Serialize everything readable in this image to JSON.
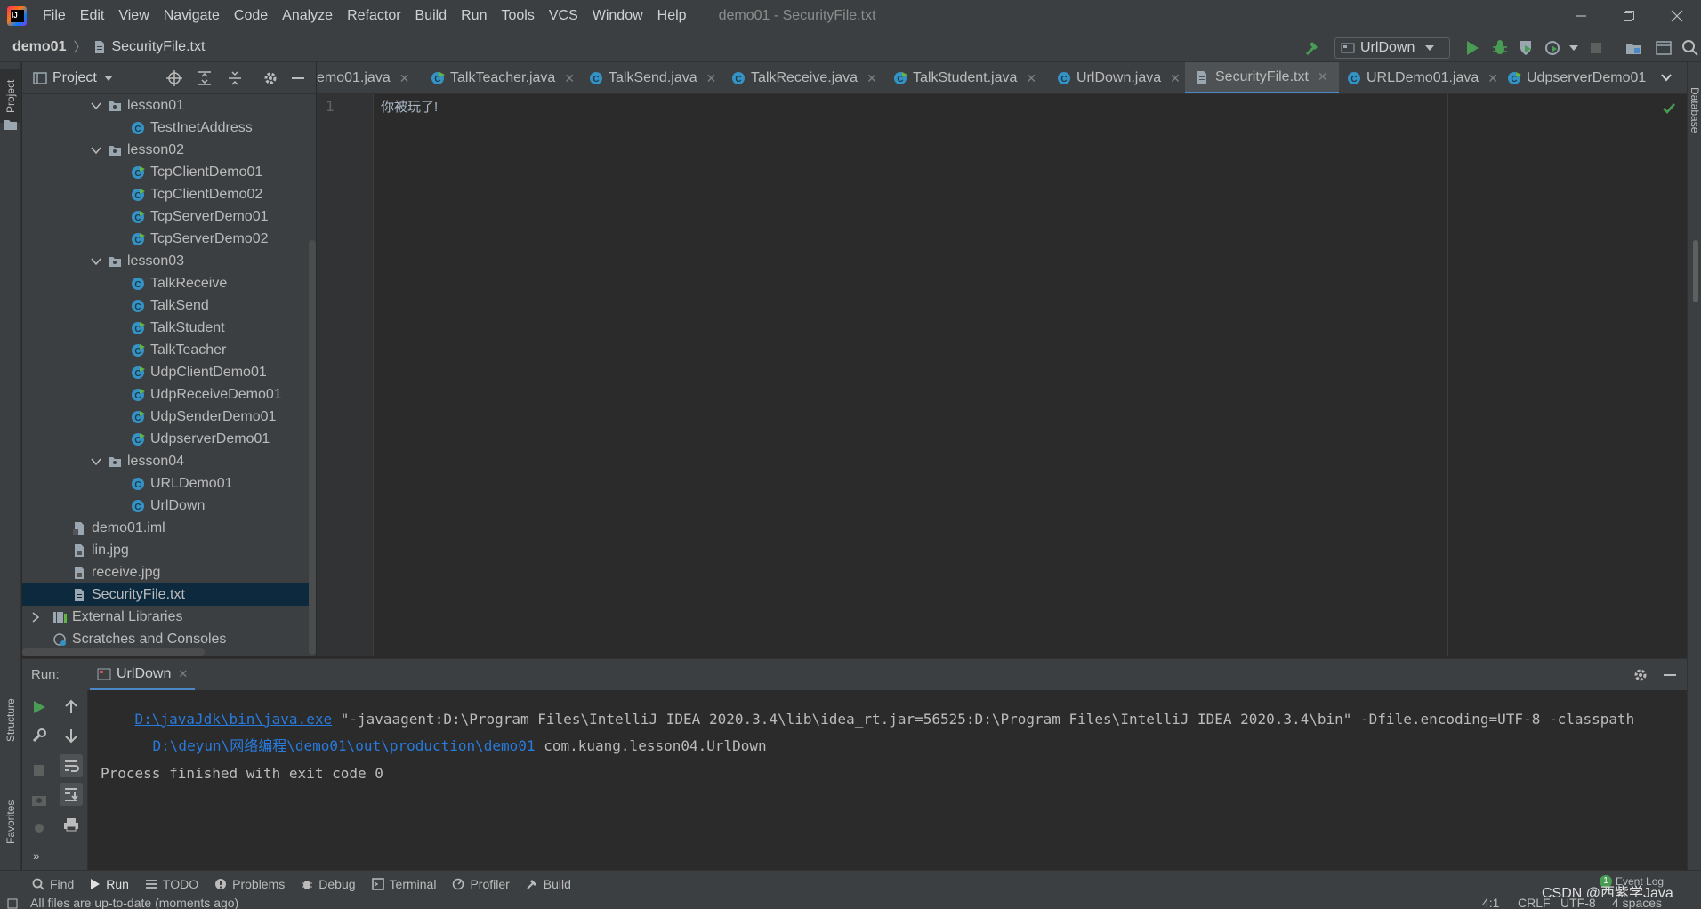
{
  "menu": {
    "items": [
      "File",
      "Edit",
      "View",
      "Navigate",
      "Code",
      "Analyze",
      "Refactor",
      "Build",
      "Run",
      "Tools",
      "VCS",
      "Window",
      "Help"
    ],
    "window_title": "demo01 - SecurityFile.txt"
  },
  "navbar": {
    "project": "demo01",
    "file": "SecurityFile.txt",
    "run_config": "UrlDown"
  },
  "project_panel": {
    "title": "Project",
    "tree": [
      {
        "label": "lesson01",
        "kind": "folder",
        "level": 1,
        "expanded": true
      },
      {
        "label": "TestInetAddress",
        "kind": "class",
        "level": 2
      },
      {
        "label": "lesson02",
        "kind": "folder",
        "level": 1,
        "expanded": true
      },
      {
        "label": "TcpClientDemo01",
        "kind": "class",
        "level": 2
      },
      {
        "label": "TcpClientDemo02",
        "kind": "class",
        "level": 2
      },
      {
        "label": "TcpServerDemo01",
        "kind": "class",
        "level": 2
      },
      {
        "label": "TcpServerDemo02",
        "kind": "class",
        "level": 2
      },
      {
        "label": "lesson03",
        "kind": "folder",
        "level": 1,
        "expanded": true
      },
      {
        "label": "TalkReceive",
        "kind": "class",
        "level": 2
      },
      {
        "label": "TalkSend",
        "kind": "class",
        "level": 2
      },
      {
        "label": "TalkStudent",
        "kind": "class",
        "level": 2
      },
      {
        "label": "TalkTeacher",
        "kind": "class",
        "level": 2
      },
      {
        "label": "UdpClientDemo01",
        "kind": "class",
        "level": 2
      },
      {
        "label": "UdpReceiveDemo01",
        "kind": "class",
        "level": 2
      },
      {
        "label": "UdpSenderDemo01",
        "kind": "class",
        "level": 2
      },
      {
        "label": "UdpserverDemo01",
        "kind": "class",
        "level": 2
      },
      {
        "label": "lesson04",
        "kind": "folder",
        "level": 1,
        "expanded": true
      },
      {
        "label": "URLDemo01",
        "kind": "class",
        "level": 2
      },
      {
        "label": "UrlDown",
        "kind": "class",
        "level": 2
      },
      {
        "label": "demo01.iml",
        "kind": "file",
        "level": 0
      },
      {
        "label": "lin.jpg",
        "kind": "file",
        "level": 0
      },
      {
        "label": "receive.jpg",
        "kind": "file",
        "level": 0
      },
      {
        "label": "SecurityFile.txt",
        "kind": "file",
        "level": 0,
        "selected": true
      },
      {
        "label": "External Libraries",
        "kind": "libraries",
        "level": -1,
        "expanded": false
      },
      {
        "label": "Scratches and Consoles",
        "kind": "scratches",
        "level": -1
      }
    ]
  },
  "editor_tabs": [
    {
      "label": "emo01.java",
      "icon": "none"
    },
    {
      "label": "TalkTeacher.java",
      "icon": "class"
    },
    {
      "label": "TalkSend.java",
      "icon": "class"
    },
    {
      "label": "TalkReceive.java",
      "icon": "class"
    },
    {
      "label": "TalkStudent.java",
      "icon": "class"
    },
    {
      "label": "UrlDown.java",
      "icon": "class"
    },
    {
      "label": "SecurityFile.txt",
      "icon": "text",
      "active": true
    },
    {
      "label": "URLDemo01.java",
      "icon": "class"
    },
    {
      "label": "UdpserverDemo01",
      "icon": "class"
    }
  ],
  "editor": {
    "line_number": "1",
    "content": "你被玩了!"
  },
  "run_panel": {
    "label": "Run:",
    "tab": "UrlDown",
    "console": {
      "line1_link": "D:\\javaJdk\\bin\\java.exe",
      "line1_rest": " \"-javaagent:D:\\Program Files\\IntelliJ IDEA 2020.3.4\\lib\\idea_rt.jar=56525:D:\\Program Files\\IntelliJ IDEA 2020.3.4\\bin\" -Dfile.encoding=UTF-8 -classpath",
      "line2_link": "D:\\deyun\\网络编程\\demo01\\out\\production\\demo01",
      "line2_rest": " com.kuang.lesson04.UrlDown",
      "line3": "Process finished with exit code 0"
    }
  },
  "side_tabs": {
    "left_top": "Project",
    "left_structure": "Structure",
    "left_favorites": "Favorites",
    "right": "Database"
  },
  "bottom_tools": [
    "Find",
    "Run",
    "TODO",
    "Problems",
    "Debug",
    "Terminal",
    "Profiler",
    "Build"
  ],
  "status": {
    "message": "All files are up-to-date (moments ago)",
    "position": "4:1",
    "line_sep": "CRLF",
    "encoding": "UTF-8",
    "indent": "4 spaces",
    "event_log": "Event Log",
    "event_count": "1",
    "watermark": "CSDN @西紫学Java"
  },
  "colors": {
    "background": "#2b2b2b",
    "panel": "#3c3f41",
    "selection": "#0d293e",
    "link": "#287bde",
    "accent": "#4a88c7",
    "run_green": "#499c54"
  }
}
